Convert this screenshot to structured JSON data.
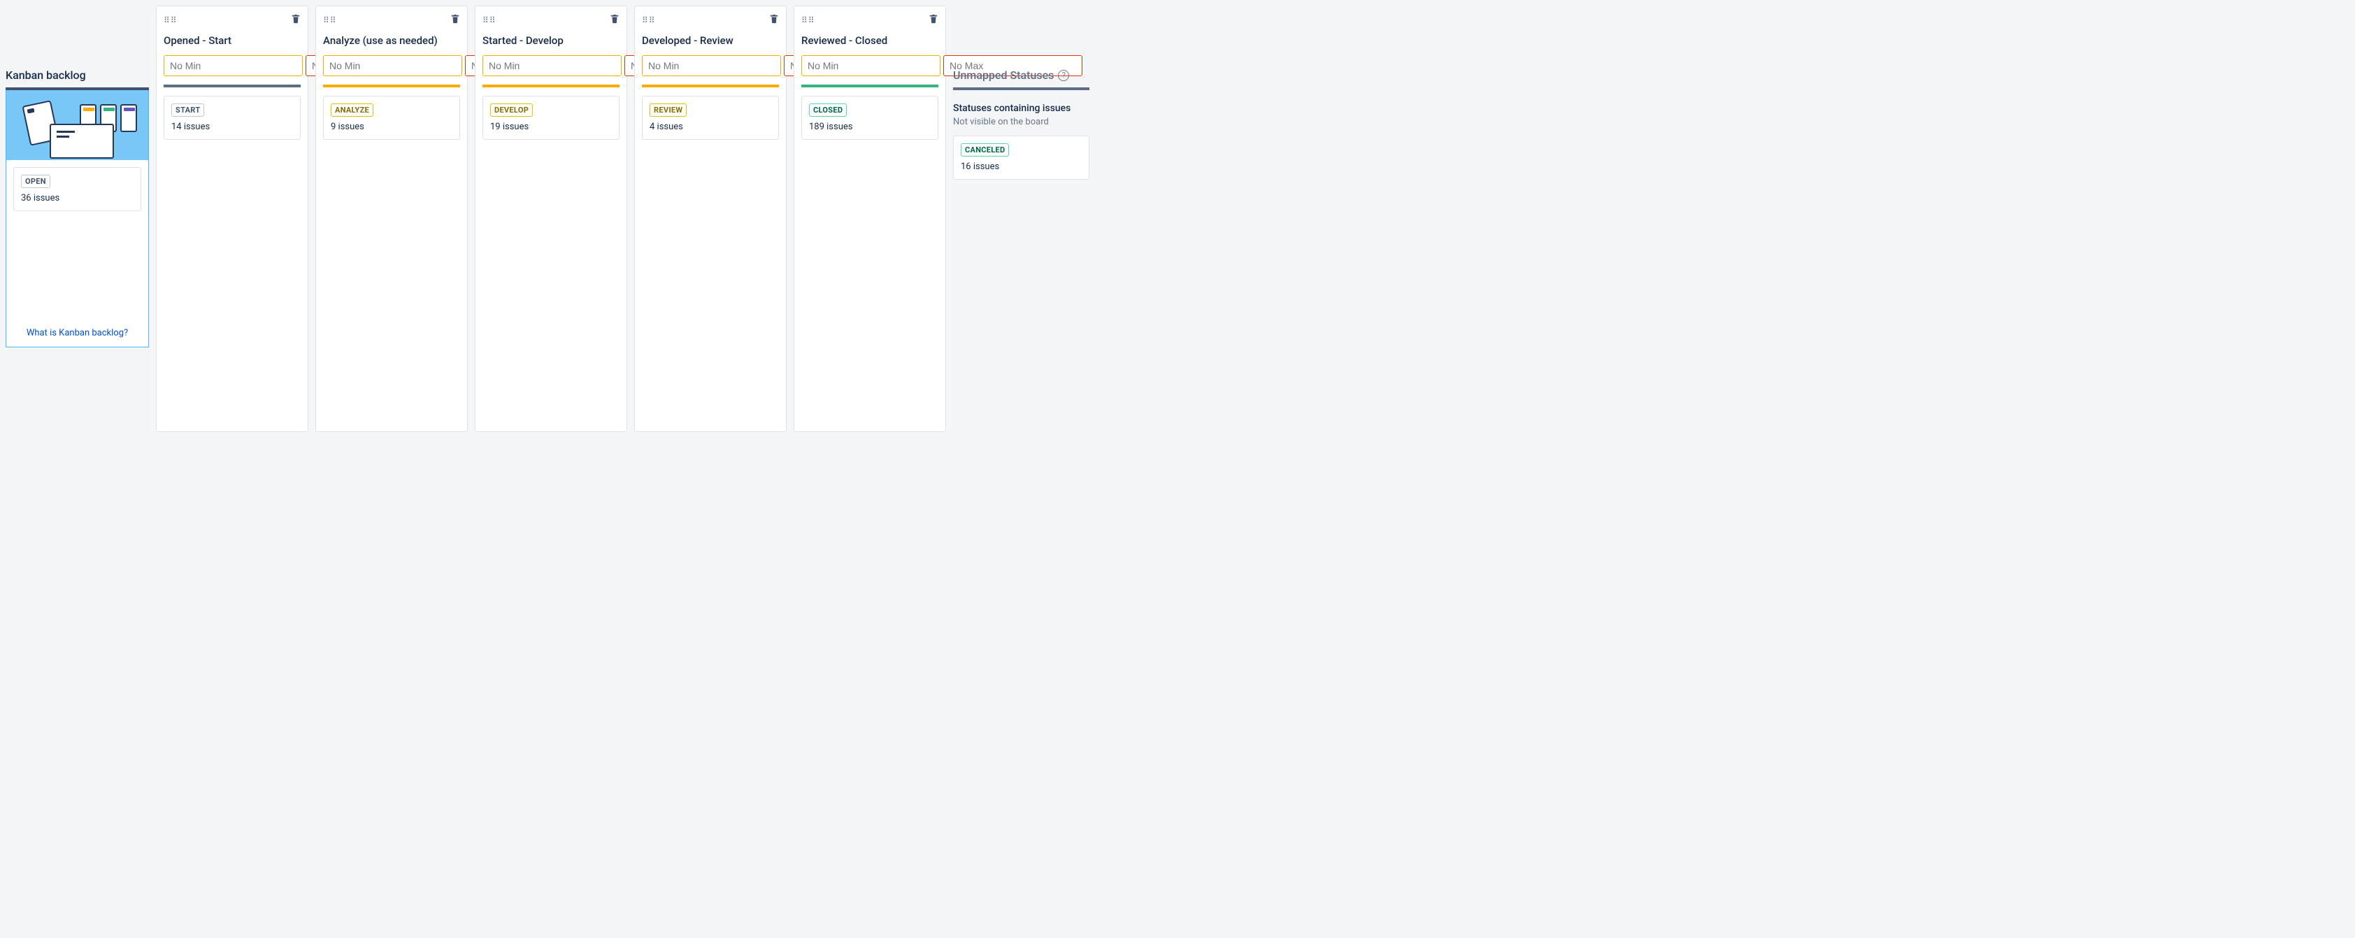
{
  "backlog": {
    "title": "Kanban backlog",
    "status_label": "OPEN",
    "issues_text": "36 issues",
    "help_link_text": "What is Kanban backlog?"
  },
  "columns": [
    {
      "title": "Opened - Start",
      "min_placeholder": "No Min",
      "max_placeholder": "No Max",
      "stripe": "grey",
      "status_label": "START",
      "status_style": "default",
      "issues_text": "14 issues"
    },
    {
      "title": "Analyze (use as needed)",
      "min_placeholder": "No Min",
      "max_placeholder": "No Max",
      "stripe": "orange",
      "status_label": "ANALYZE",
      "status_style": "yellow",
      "issues_text": "9 issues"
    },
    {
      "title": "Started - Develop",
      "min_placeholder": "No Min",
      "max_placeholder": "No Max",
      "stripe": "orange",
      "status_label": "DEVELOP",
      "status_style": "yellow",
      "issues_text": "19 issues"
    },
    {
      "title": "Developed - Review",
      "min_placeholder": "No Min",
      "max_placeholder": "No Max",
      "stripe": "orange",
      "status_label": "REVIEW",
      "status_style": "yellow",
      "issues_text": "4 issues"
    },
    {
      "title": "Reviewed - Closed",
      "min_placeholder": "No Min",
      "max_placeholder": "No Max",
      "stripe": "green",
      "status_label": "CLOSED",
      "status_style": "green",
      "issues_text": "189 issues"
    }
  ],
  "unmapped": {
    "title": "Unmapped Statuses",
    "subtitle": "Statuses containing issues",
    "note": "Not visible on the board",
    "status_label": "CANCELED",
    "issues_text": "16 issues"
  }
}
